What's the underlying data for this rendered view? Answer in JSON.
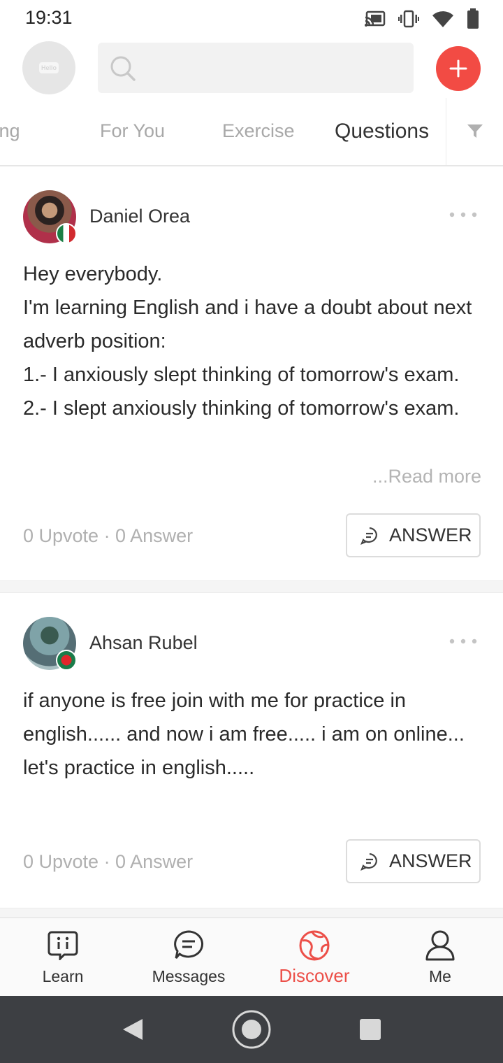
{
  "status_bar": {
    "time": "19:31",
    "icons": [
      "cast-icon",
      "vibrate-icon",
      "wifi-icon",
      "battery-icon"
    ]
  },
  "header": {
    "avatar_logo": "Hello",
    "search": {
      "value": "",
      "placeholder": ""
    },
    "add_icon": "plus-icon"
  },
  "tabs": [
    {
      "label": "Following",
      "visible_label": "owing",
      "active": false
    },
    {
      "label": "For You",
      "active": false
    },
    {
      "label": "Exercise",
      "active": false
    },
    {
      "label": "Questions",
      "active": true
    }
  ],
  "filter_icon": "filter-icon",
  "posts": [
    {
      "user_name": "Daniel Orea",
      "flag": "mexico-flag",
      "lines": [
        "Hey everybody.",
        "I'm learning English and  i have a doubt about next adverb position:",
        "1.- I anxiously slept thinking of tomorrow's exam.",
        "2.- I slept anxiously thinking of tomorrow's exam."
      ],
      "read_more": "...Read more",
      "stats": "0 Upvote · 0 Answer",
      "answer_label": "ANSWER"
    },
    {
      "user_name": "Ahsan Rubel",
      "flag": "bangladesh-flag",
      "lines": [
        "if anyone is free join with me for practice in english...... and now i am free..... i am on online...",
        "let's practice in english....."
      ],
      "stats": "0 Upvote · 0 Answer",
      "answer_label": "ANSWER"
    }
  ],
  "bottom_nav": [
    {
      "label": "Learn",
      "icon": "learn-icon",
      "active": false
    },
    {
      "label": "Messages",
      "icon": "messages-icon",
      "active": false
    },
    {
      "label": "Discover",
      "icon": "discover-icon",
      "active": true
    },
    {
      "label": "Me",
      "icon": "profile-icon",
      "active": false
    }
  ],
  "colors": {
    "accent": "#f24b44",
    "active_nav": "#ec4f48",
    "inactive_tab": "#a8a8a8",
    "system_nav_bg": "#3d3f43"
  }
}
